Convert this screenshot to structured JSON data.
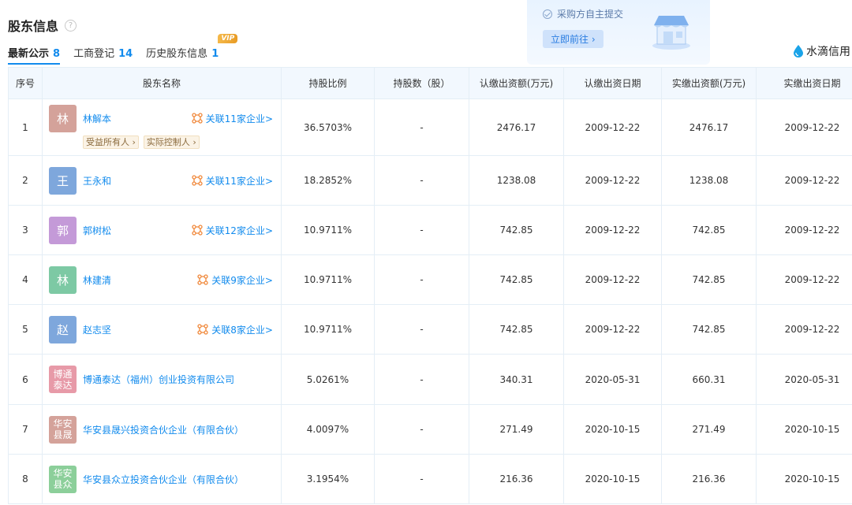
{
  "header": {
    "title": "股东信息",
    "help_icon": "?"
  },
  "tabs": [
    {
      "label": "最新公示",
      "count": "8"
    },
    {
      "label": "工商登记",
      "count": "14"
    },
    {
      "label": "历史股东信息",
      "count": "1",
      "badge": "VIP"
    }
  ],
  "promo": {
    "text": "采购方自主提交",
    "button": "立即前往 ›"
  },
  "brand": {
    "name": "水滴信用"
  },
  "table": {
    "headers": [
      "序号",
      "股东名称",
      "持股比例",
      "持股数（股）",
      "认缴出资额(万元)",
      "认缴出资日期",
      "实缴出资额(万元)",
      "实缴出资日期"
    ],
    "rows": [
      {
        "idx": "1",
        "avatar": "林",
        "avatar2": "",
        "name": "林解本",
        "assoc": "关联11家企业>",
        "tags": [
          "受益所有人 ›",
          "实际控制人 ›"
        ],
        "ratio": "36.5703%",
        "shares": "-",
        "sub_amt": "2476.17",
        "sub_date": "2009-12-22",
        "paid_amt": "2476.17",
        "paid_date": "2009-12-22"
      },
      {
        "idx": "2",
        "avatar": "王",
        "avatar2": "",
        "name": "王永和",
        "assoc": "关联11家企业>",
        "tags": [],
        "ratio": "18.2852%",
        "shares": "-",
        "sub_amt": "1238.08",
        "sub_date": "2009-12-22",
        "paid_amt": "1238.08",
        "paid_date": "2009-12-22"
      },
      {
        "idx": "3",
        "avatar": "郭",
        "avatar2": "",
        "name": "郭树松",
        "assoc": "关联12家企业>",
        "tags": [],
        "ratio": "10.9711%",
        "shares": "-",
        "sub_amt": "742.85",
        "sub_date": "2009-12-22",
        "paid_amt": "742.85",
        "paid_date": "2009-12-22"
      },
      {
        "idx": "4",
        "avatar": "林",
        "avatar2": "",
        "name": "林建清",
        "assoc": "关联9家企业>",
        "tags": [],
        "ratio": "10.9711%",
        "shares": "-",
        "sub_amt": "742.85",
        "sub_date": "2009-12-22",
        "paid_amt": "742.85",
        "paid_date": "2009-12-22"
      },
      {
        "idx": "5",
        "avatar": "赵",
        "avatar2": "",
        "name": "赵志坚",
        "assoc": "关联8家企业>",
        "tags": [],
        "ratio": "10.9711%",
        "shares": "-",
        "sub_amt": "742.85",
        "sub_date": "2009-12-22",
        "paid_amt": "742.85",
        "paid_date": "2009-12-22"
      },
      {
        "idx": "6",
        "avatar": "博通",
        "avatar2": "泰达",
        "name": "博通泰达（福州）创业投资有限公司",
        "assoc": "",
        "tags": [],
        "ratio": "5.0261%",
        "shares": "-",
        "sub_amt": "340.31",
        "sub_date": "2020-05-31",
        "paid_amt": "660.31",
        "paid_date": "2020-05-31"
      },
      {
        "idx": "7",
        "avatar": "华安",
        "avatar2": "县晟",
        "name": "华安县晟兴投资合伙企业（有限合伙）",
        "assoc": "",
        "tags": [],
        "ratio": "4.0097%",
        "shares": "-",
        "sub_amt": "271.49",
        "sub_date": "2020-10-15",
        "paid_amt": "271.49",
        "paid_date": "2020-10-15"
      },
      {
        "idx": "8",
        "avatar": "华安",
        "avatar2": "县众",
        "name": "华安县众立投资合伙企业（有限合伙）",
        "assoc": "",
        "tags": [],
        "ratio": "3.1954%",
        "shares": "-",
        "sub_amt": "216.36",
        "sub_date": "2020-10-15",
        "paid_amt": "216.36",
        "paid_date": "2020-10-15"
      }
    ]
  },
  "colors": {
    "accent": "#128bed",
    "avatars": [
      "#d4a29a",
      "#7ea7dc",
      "#c49ad8",
      "#7dc9a4",
      "#7ea7dc",
      "#e79aa8",
      "#d4a29a",
      "#8ccf9a"
    ]
  },
  "icons": {
    "help": "question-circle-icon",
    "check": "check-circle-icon",
    "assoc": "network-icon",
    "brand": "water-drop-icon",
    "shop": "storefront-icon"
  }
}
